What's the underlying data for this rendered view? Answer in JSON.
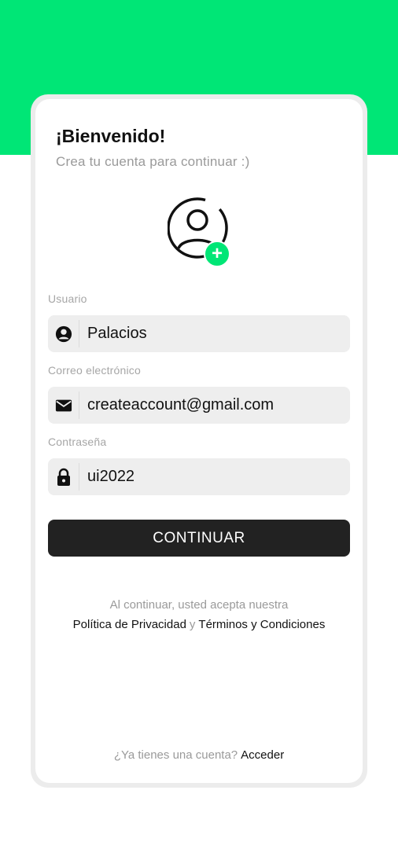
{
  "header": {
    "title": "¡Bienvenido!",
    "subtitle": "Crea tu cuenta para continuar :)"
  },
  "avatar": {
    "icon": "user-add-icon",
    "badge": "+"
  },
  "form": {
    "username": {
      "label": "Usuario",
      "value": "Palacios",
      "icon": "person-icon"
    },
    "email": {
      "label": "Correo electrónico",
      "value": "createaccount@gmail.com",
      "icon": "mail-icon"
    },
    "password": {
      "label": "Contraseña",
      "value": "ui2022",
      "icon": "lock-icon"
    }
  },
  "submit": {
    "label": "CONTINUAR"
  },
  "legal": {
    "intro": "Al continuar, usted acepta nuestra",
    "privacy": "Política de Privacidad",
    "conj": "y",
    "terms": "Términos y Condiciones"
  },
  "footer": {
    "prompt": "¿Ya tienes una cuenta?",
    "link": "Acceder"
  },
  "colors": {
    "accent": "#00e676",
    "button": "#222222",
    "field_bg": "#eeeeee"
  }
}
